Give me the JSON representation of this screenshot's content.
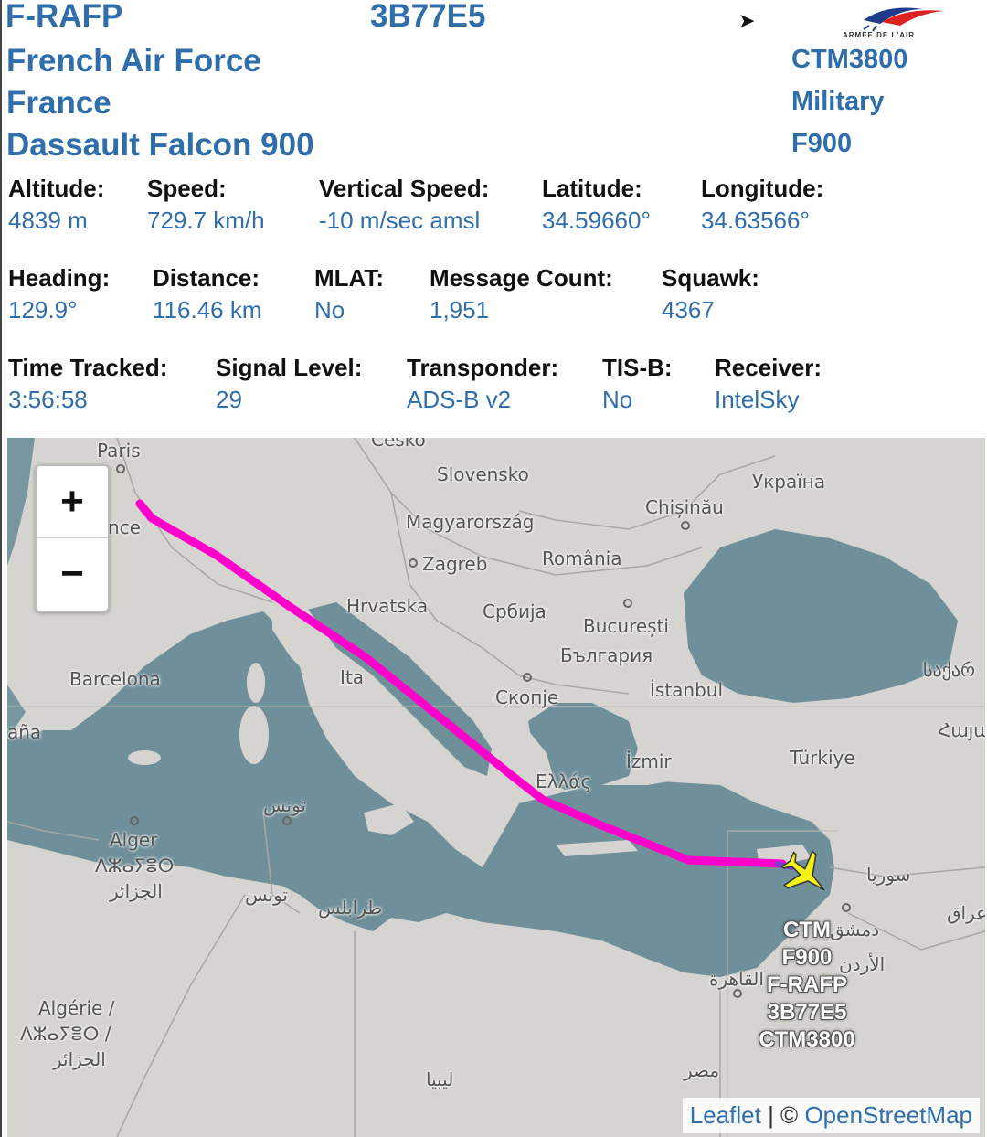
{
  "header": {
    "registration": "F-RAFP",
    "hex": "3B77E5",
    "operator": "French Air Force",
    "country": "France",
    "aircraft": "Dassault Falcon 900",
    "callsign": "CTM3800",
    "category": "Military",
    "type_code": "F900",
    "logo_text": "ARMÉE DE L'AIR"
  },
  "stats": [
    {
      "label": "Altitude:",
      "value": "4839 m"
    },
    {
      "label": "Speed:",
      "value": "729.7 km/h"
    },
    {
      "label": "Vertical Speed:",
      "value": "-10 m/sec amsl"
    },
    {
      "label": "Latitude:",
      "value": "34.59660°"
    },
    {
      "label": "Longitude:",
      "value": "34.63566°"
    },
    {
      "label": "Heading:",
      "value": "129.9°"
    },
    {
      "label": "Distance:",
      "value": "116.46 km"
    },
    {
      "label": "MLAT:",
      "value": "No"
    },
    {
      "label": "Message Count:",
      "value": "1,951"
    },
    {
      "label": "Squawk:",
      "value": "4367"
    },
    {
      "label": "Time Tracked:",
      "value": "3:56:58"
    },
    {
      "label": "Signal Level:",
      "value": "29"
    },
    {
      "label": "Transponder:",
      "value": "ADS-B v2"
    },
    {
      "label": "TIS-B:",
      "value": "No"
    },
    {
      "label": "Receiver:",
      "value": "IntelSky"
    }
  ],
  "map": {
    "zoom_in": "+",
    "zoom_out": "−",
    "places": {
      "paris": "Paris",
      "france": "nce",
      "cesko": "Česko",
      "slovensko": "Slovensko",
      "ukraine": "Україна",
      "chisinau": "Chișinău",
      "magyar": "Magyarország",
      "zagreb": "Zagreb",
      "romania": "România",
      "hrvatska": "Hrvatska",
      "srbija": "Србија",
      "bucuresti": "București",
      "bulgaria": "България",
      "barcelona": "Barcelona",
      "italia": "Ita",
      "skopje": "Скопје",
      "istanbul": "İstanbul",
      "georgia": "საქარ",
      "spain": "aña",
      "armenia": "Հայա",
      "izmir": "İzmir",
      "turkiye": "Türkiye",
      "ellas": "Ελλάς",
      "tunis": "تونس",
      "alger": "Alger",
      "alger_tif": "ⴷⵣⴰⵢⴻⵔ",
      "alger_ar": "الجزائر",
      "tunisia": "تونس",
      "tripoli": "طرابلس",
      "syria": "سوريا",
      "damascus": "دمشق",
      "iraq": "عراق",
      "jordan": "الأردن",
      "cairo": "القاهرة",
      "algerie": "Algérie /",
      "algerie_tif": "ⴷⵣⴰⵢⴻⵔ /",
      "algerie_ar": "الجزائر",
      "libya": "ليبيا",
      "egypt": "مصر"
    },
    "aircraft_label": [
      "CTM",
      "F900",
      "F-RAFP",
      "3B77E5",
      "CTM3800"
    ],
    "attribution_leaflet": "Leaflet",
    "attribution_sep": " | © ",
    "attribution_osm": "OpenStreetMap",
    "track_color": "#ff00cc",
    "sea_color": "#6f8f9a",
    "aircraft_color": "#f5f21a"
  }
}
